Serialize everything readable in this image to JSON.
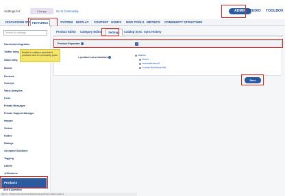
{
  "topbar": {
    "settings_for_label": "Settings for:",
    "change_label": "Change",
    "goto_label": "Go to Community",
    "nav": [
      "ADMIN",
      "STUDIO",
      "TOOLBOX"
    ]
  },
  "main_tabs": [
    "DISCUSSION STYLES",
    "FEATURES",
    "SYSTEM",
    "DISPLAY",
    "CONTENT",
    "USERS",
    "MOD TOOLS",
    "METRICS",
    "COMMUNITY STRUCTURE"
  ],
  "sidebar": {
    "search_placeholder": "Search for settings",
    "items": [
      "Facebook Integration",
      "Twitter Integ",
      "Slack Integ",
      "Mobile",
      "Reviews",
      "Surveys",
      "Value Analytics",
      "Polls",
      "Private Messages",
      "Private Support Manager",
      "Images",
      "Videos",
      "Kudos",
      "Ratings",
      "Accepted Solutions",
      "Tagging",
      "Labels",
      "@Mentions"
    ],
    "active_item": "Products",
    "after_item": "Ask a Question"
  },
  "sub_tabs": [
    "Product Editor",
    "Category Editor",
    "Settings",
    "Catalog Sync",
    "Sync History"
  ],
  "settings": {
    "product_expander_label": "Product Expander",
    "product_expander_checked": true,
    "tooltip_text": "Enable to collapse associated products view on community posts",
    "conversations_label": "r product conversations",
    "tree": [
      "atlantis",
      "llinum",
      "kumarabusecolf",
      "KumarUserAbuseHolf"
    ]
  },
  "save_label": "Save",
  "status_url": "https://.../t5/admin/products/Intel/tabs/settings/aFilter=1&amp;wide=1"
}
